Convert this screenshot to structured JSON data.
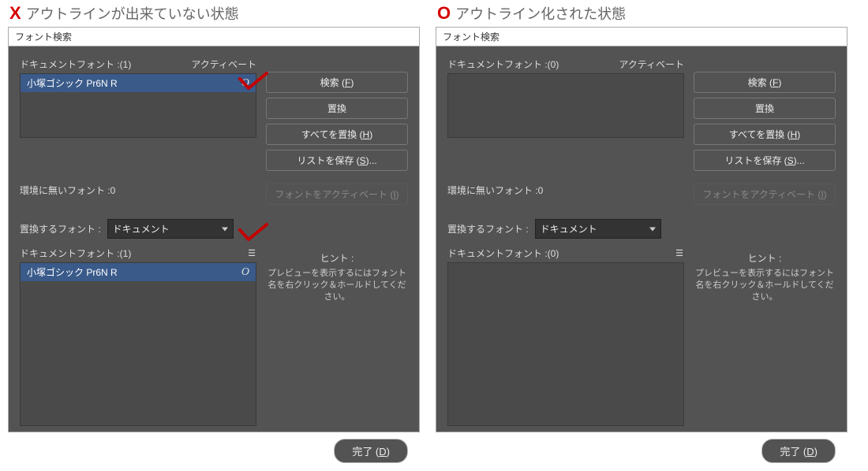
{
  "captions": {
    "left_mark": "X",
    "left_text": "アウトラインが出来ていない状態",
    "right_mark": "O",
    "right_text": "アウトライン化された状態"
  },
  "left": {
    "title": "フォント検索",
    "doc_fonts_label": "ドキュメントフォント :",
    "doc_fonts_count": "(1)",
    "activate_label": "アクティベート",
    "font_item": "小塚ゴシック Pr6N R",
    "buttons": {
      "find": "検索 (",
      "find_u": "F",
      "find_end": ")",
      "replace": "置換",
      "replace_all": "すべてを置換 (",
      "replace_all_u": "H",
      "replace_all_end": ")",
      "save_list": "リストを保存 (",
      "save_list_u": "S",
      "save_list_end": ")...",
      "activate_font": "フォントをアクティベート (",
      "activate_font_u": "I",
      "activate_font_end": ")"
    },
    "env_label": "環境に無いフォント :",
    "env_count": "0",
    "replace_with_label": "置換するフォント :",
    "replace_with_value": "ドキュメント",
    "doc2_label": "ドキュメントフォント :",
    "doc2_count": "(1)",
    "doc2_item": "小塚ゴシック Pr6N R",
    "glyph": "O",
    "hint_title": "ヒント :",
    "hint_body": "プレビューを表示するにはフォント名を右クリック＆ホールドしてください。",
    "done": "完了 (",
    "done_u": "D",
    "done_end": ")"
  },
  "right": {
    "title": "フォント検索",
    "doc_fonts_label": "ドキュメントフォント :",
    "doc_fonts_count": "(0)",
    "activate_label": "アクティベート",
    "buttons": {
      "find": "検索 (",
      "find_u": "F",
      "find_end": ")",
      "replace": "置換",
      "replace_all": "すべてを置換 (",
      "replace_all_u": "H",
      "replace_all_end": ")",
      "save_list": "リストを保存 (",
      "save_list_u": "S",
      "save_list_end": ")...",
      "activate_font": "フォントをアクティベート (",
      "activate_font_u": "I",
      "activate_font_end": ")"
    },
    "env_label": "環境に無いフォント :",
    "env_count": "0",
    "replace_with_label": "置換するフォント :",
    "replace_with_value": "ドキュメント",
    "doc2_label": "ドキュメントフォント :",
    "doc2_count": "(0)",
    "hint_title": "ヒント :",
    "hint_body": "プレビューを表示するにはフォント名を右クリック＆ホールドしてください。",
    "done": "完了 (",
    "done_u": "D",
    "done_end": ")"
  }
}
